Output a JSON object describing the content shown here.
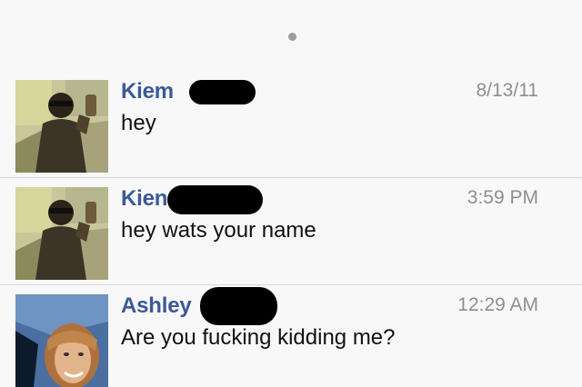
{
  "conversations": [
    {
      "sender": "Kiem",
      "preview": "hey",
      "time": "8/13/11",
      "avatar_icon": "selfie-photo-icon"
    },
    {
      "sender": "Kien",
      "preview": "hey wats your name",
      "time": "3:59 PM",
      "avatar_icon": "selfie-photo-icon"
    },
    {
      "sender": "Ashley",
      "preview": "Are you fucking kidding me?",
      "time": "12:29 AM",
      "avatar_icon": "profile-photo-icon"
    }
  ],
  "colors": {
    "sender_name": "#3b5998",
    "timestamp": "#8f8f8f",
    "divider": "#d9d9d9",
    "background": "#f8f8f8"
  }
}
